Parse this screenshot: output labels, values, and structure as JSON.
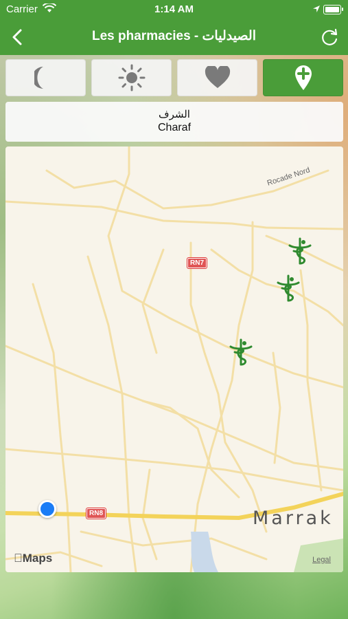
{
  "status_bar": {
    "carrier": "Carrier",
    "time": "1:14 AM"
  },
  "nav": {
    "title": "Les pharmacies - الصيدليات"
  },
  "segments": [
    {
      "icon": "moon-icon",
      "active": false
    },
    {
      "icon": "sun-icon",
      "active": false
    },
    {
      "icon": "heart-icon",
      "active": false
    },
    {
      "icon": "pharmacy-location-icon",
      "active": true
    }
  ],
  "pharmacy": {
    "name_ar": "الشرف",
    "name_fr": "Charaf"
  },
  "map": {
    "road_labels": {
      "rocade": "Rocade Nord",
      "rn7": "RN7",
      "rn8": "RN8",
      "city": "Marrak"
    },
    "attribution": "Maps",
    "legal": "Legal",
    "pharmacy_pin_count": 3
  },
  "colors": {
    "primary": "#4a9d39",
    "pin": "#2f8a2f",
    "user_location": "#1a7cf6"
  }
}
